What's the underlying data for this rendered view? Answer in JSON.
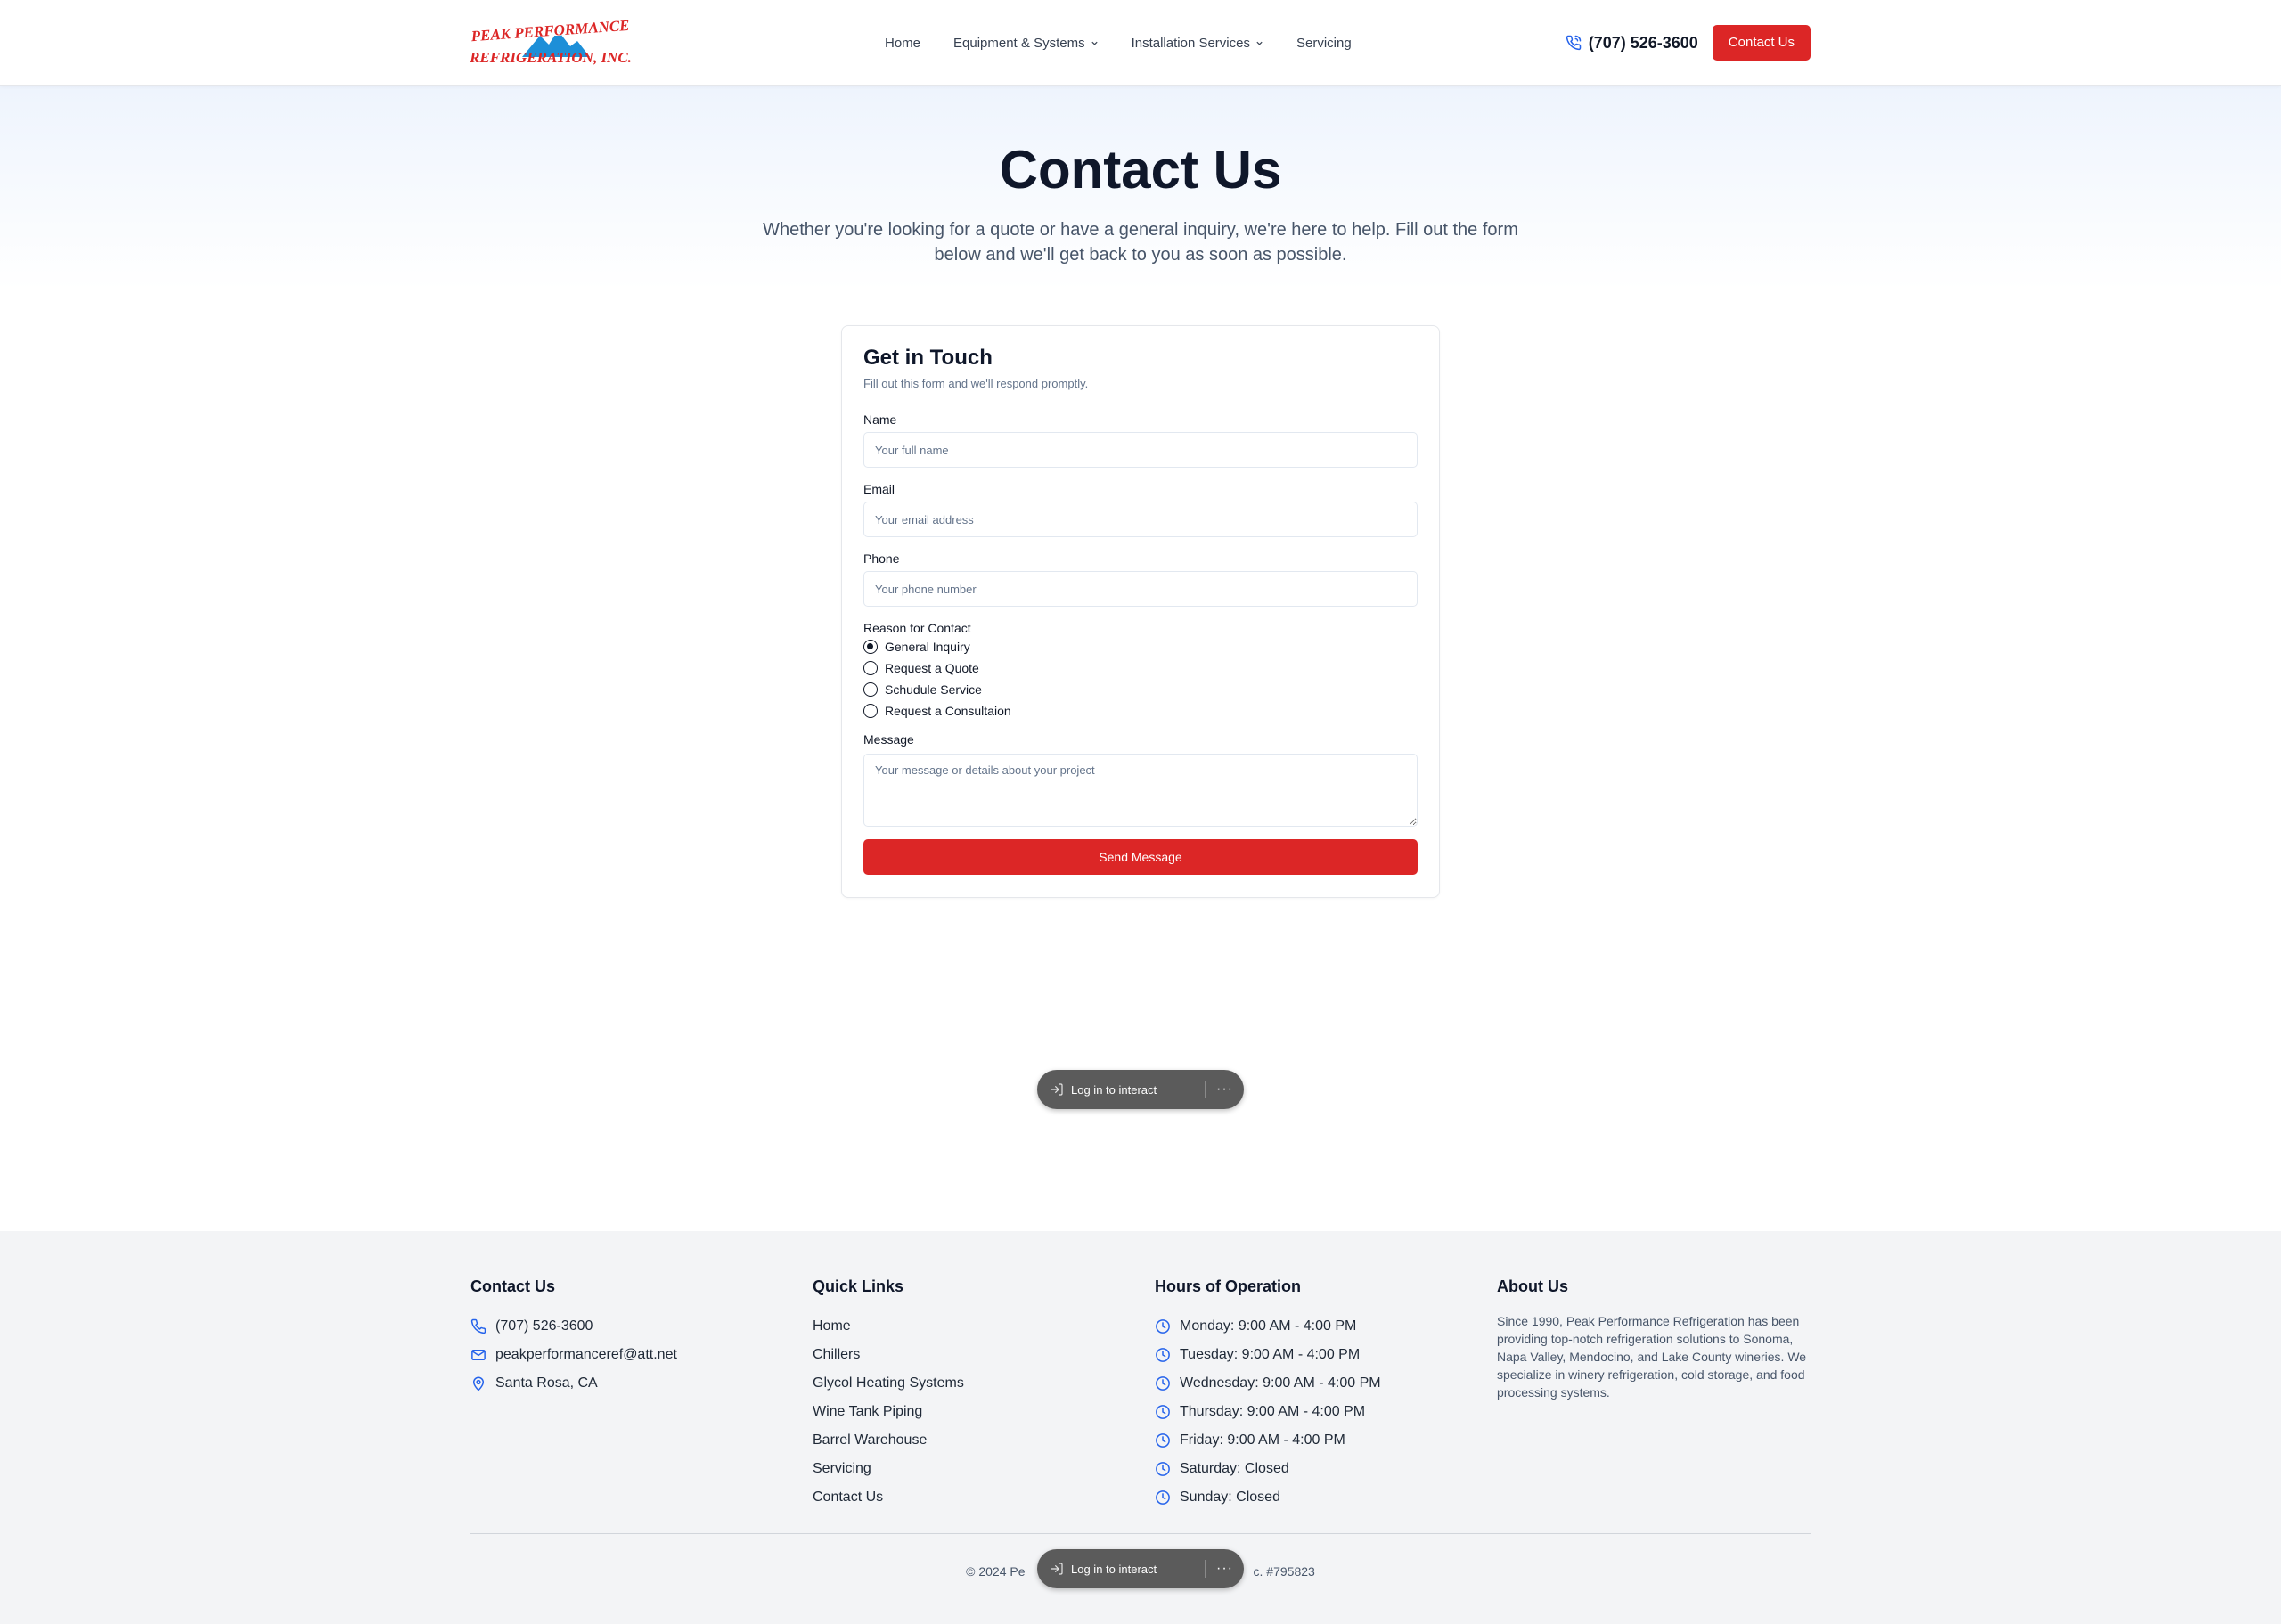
{
  "brand": {
    "line1": "PEAK PERFORMANCE",
    "line2": "REFRIGERATION, INC.",
    "colors": {
      "red": "#dc2626",
      "blue": "#1d8fd8"
    }
  },
  "nav": {
    "items": [
      {
        "label": "Home",
        "dropdown": false
      },
      {
        "label": "Equipment & Systems",
        "dropdown": true
      },
      {
        "label": "Installation Services",
        "dropdown": true
      },
      {
        "label": "Servicing",
        "dropdown": false
      }
    ],
    "phone": "(707) 526-3600",
    "cta": "Contact Us"
  },
  "hero": {
    "title": "Contact Us",
    "subtitle": "Whether you're looking for a quote or have a general inquiry, we're here to help. Fill out the form below and we'll get back to you as soon as possible."
  },
  "form": {
    "title": "Get in Touch",
    "subtitle": "Fill out this form and we'll respond promptly.",
    "name_label": "Name",
    "name_placeholder": "Your full name",
    "email_label": "Email",
    "email_placeholder": "Your email address",
    "phone_label": "Phone",
    "phone_placeholder": "Your phone number",
    "reason_label": "Reason for Contact",
    "reasons": [
      {
        "label": "General Inquiry",
        "checked": true
      },
      {
        "label": "Request a Quote",
        "checked": false
      },
      {
        "label": "Schudule Service",
        "checked": false
      },
      {
        "label": "Request a Consultaion",
        "checked": false
      }
    ],
    "message_label": "Message",
    "message_placeholder": "Your message or details about your project",
    "submit": "Send Message"
  },
  "toolbar": {
    "login": "Log in to interact",
    "more": "···"
  },
  "footer": {
    "contact": {
      "title": "Contact Us",
      "phone": "(707) 526-3600",
      "email": "peakperformanceref@att.net",
      "location": "Santa Rosa, CA"
    },
    "links": {
      "title": "Quick Links",
      "items": [
        "Home",
        "Chillers",
        "Glycol Heating Systems",
        "Wine Tank Piping",
        "Barrel Warehouse",
        "Servicing",
        "Contact Us"
      ]
    },
    "hours": {
      "title": "Hours of Operation",
      "items": [
        "Monday: 9:00 AM - 4:00 PM",
        "Tuesday: 9:00 AM - 4:00 PM",
        "Wednesday: 9:00 AM - 4:00 PM",
        "Thursday: 9:00 AM - 4:00 PM",
        "Friday: 9:00 AM - 4:00 PM",
        "Saturday: Closed",
        "Sunday: Closed"
      ]
    },
    "about": {
      "title": "About Us",
      "text": "Since 1990, Peak Performance Refrigeration has been providing top-notch refrigeration solutions to Sonoma, Napa Valley, Mendocino, and Lake County wineries. We specialize in winery refrigeration, cold storage, and food processing systems."
    },
    "copyright_left": "© 2024 Pe",
    "copyright_right": "c. #795823"
  }
}
